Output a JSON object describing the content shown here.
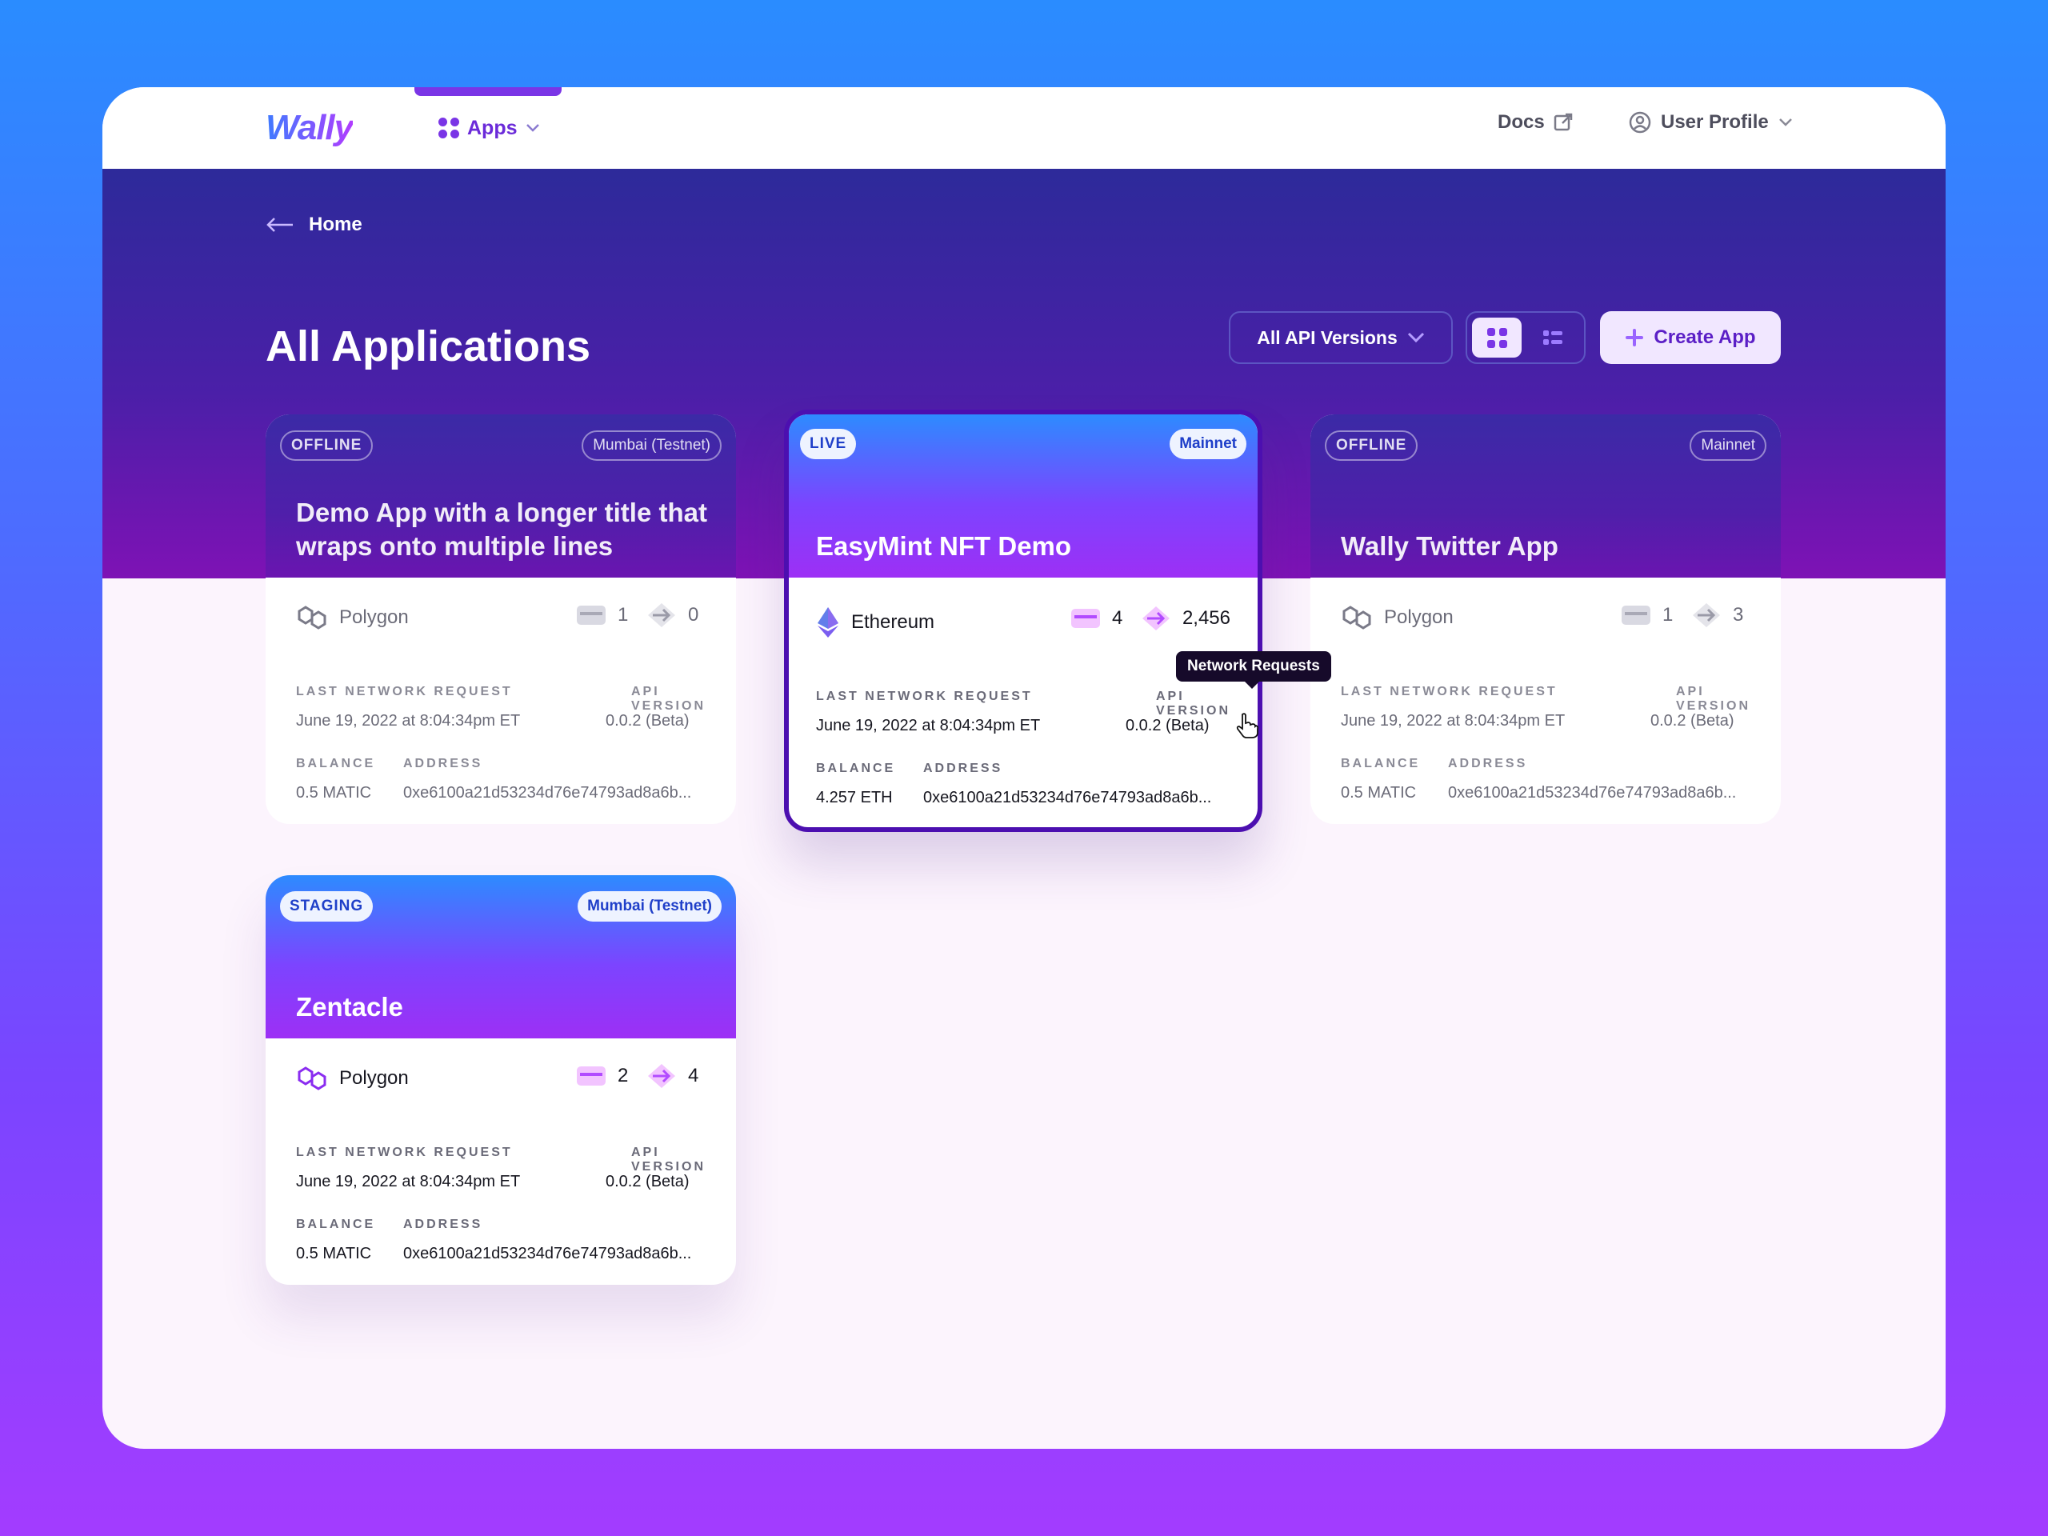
{
  "nav": {
    "logo": "Wally",
    "apps_label": "Apps",
    "docs_label": "Docs",
    "profile_label": "User Profile"
  },
  "breadcrumb": {
    "home": "Home"
  },
  "page": {
    "title": "All Applications",
    "versions_label": "All API Versions",
    "create_label": "Create App"
  },
  "labels": {
    "last_request": "LAST NETWORK REQUEST",
    "api_version": "API VERSION",
    "balance": "BALANCE",
    "address": "ADDRESS"
  },
  "tooltip": "Network Requests",
  "cards": [
    {
      "status": "OFFLINE",
      "network": "Mumbai (Testnet)",
      "title": "Demo App with a longer title that wraps onto multiple lines",
      "chain": "Polygon",
      "keys": "1",
      "requests": "0",
      "last_request": "June 19, 2022 at 8:04:34pm ET",
      "api_version": "0.0.2 (Beta)",
      "balance": "0.5 MATIC",
      "address": "0xe6100a21d53234d76e74793ad8a6b..."
    },
    {
      "status": "LIVE",
      "network": "Mainnet",
      "title": "EasyMint NFT Demo",
      "chain": "Ethereum",
      "keys": "4",
      "requests": "2,456",
      "last_request": "June 19, 2022 at 8:04:34pm ET",
      "api_version": "0.0.2 (Beta)",
      "balance": "4.257 ETH",
      "address": "0xe6100a21d53234d76e74793ad8a6b..."
    },
    {
      "status": "OFFLINE",
      "network": "Mainnet",
      "title": "Wally Twitter App",
      "chain": "Polygon",
      "keys": "1",
      "requests": "3",
      "last_request": "June 19, 2022 at 8:04:34pm ET",
      "api_version": "0.0.2 (Beta)",
      "balance": "0.5 MATIC",
      "address": "0xe6100a21d53234d76e74793ad8a6b..."
    },
    {
      "status": "STAGING",
      "network": "Mumbai (Testnet)",
      "title": "Zentacle",
      "chain": "Polygon",
      "keys": "2",
      "requests": "4",
      "last_request": "June 19, 2022 at 8:04:34pm ET",
      "api_version": "0.0.2 (Beta)",
      "balance": "0.5 MATIC",
      "address": "0xe6100a21d53234d76e74793ad8a6b..."
    }
  ]
}
